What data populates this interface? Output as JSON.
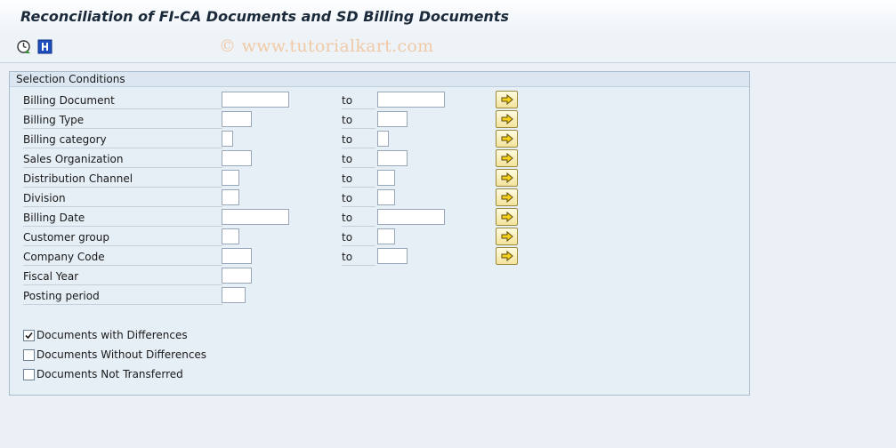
{
  "window": {
    "title": "Reconciliation of FI-CA Documents and SD Billing Documents",
    "watermark": "© www.tutorialkart.com"
  },
  "toolbar": {
    "buttons": [
      {
        "icon": "execute-clock-icon"
      },
      {
        "icon": "info-icon"
      }
    ]
  },
  "selection": {
    "group_title": "Selection Conditions",
    "to_label": "to",
    "fields": [
      {
        "label": "Billing Document",
        "low": "",
        "high": "",
        "multiple_selection_icon": "arrow-right-icon"
      },
      {
        "label": "Billing Type",
        "low": "",
        "high": "",
        "multiple_selection_icon": "arrow-right-icon"
      },
      {
        "label": "Billing category",
        "low": "",
        "high": "",
        "multiple_selection_icon": "arrow-right-icon"
      },
      {
        "label": "Sales Organization",
        "low": "",
        "high": "",
        "multiple_selection_icon": "arrow-right-icon"
      },
      {
        "label": "Distribution Channel",
        "low": "",
        "high": "",
        "multiple_selection_icon": "arrow-right-icon"
      },
      {
        "label": "Division",
        "low": "",
        "high": "",
        "multiple_selection_icon": "arrow-right-icon"
      },
      {
        "label": "Billing Date",
        "low": "",
        "high": "",
        "multiple_selection_icon": "arrow-right-icon"
      },
      {
        "label": "Customer group",
        "low": "",
        "high": "",
        "multiple_selection_icon": "arrow-right-icon"
      },
      {
        "label": "Company Code",
        "low": "",
        "high": "",
        "multiple_selection_icon": "arrow-right-icon"
      },
      {
        "label": "Fiscal Year",
        "low": ""
      },
      {
        "label": "Posting period",
        "low": ""
      }
    ],
    "options": [
      {
        "label": "Documents with Differences",
        "checked": true
      },
      {
        "label": "Documents Without Differences",
        "checked": false
      },
      {
        "label": "Documents Not Transferred",
        "checked": false
      }
    ]
  },
  "colors": {
    "background": "#e5ecf3",
    "group_border": "#a9bccd",
    "button_yellow": "#f3e39b",
    "watermark": "#f0c9a6"
  }
}
